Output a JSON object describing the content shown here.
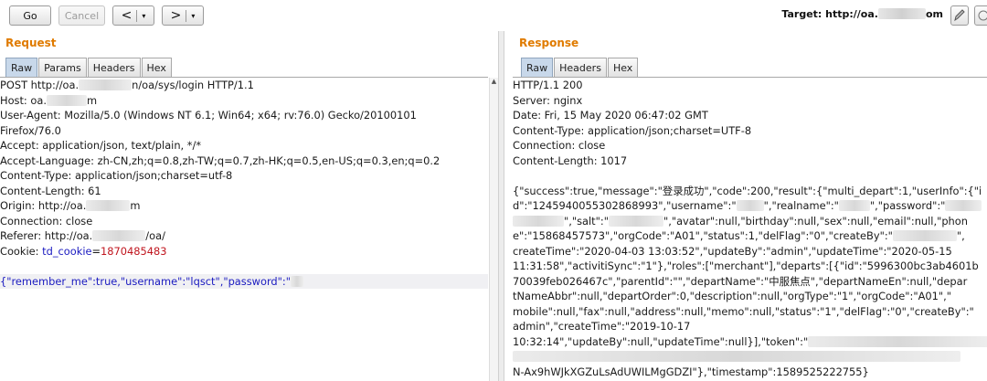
{
  "toolbar": {
    "go_label": "Go",
    "cancel_label": "Cancel",
    "back_label": "<",
    "forward_label": ">",
    "dropdown_glyph": "▾",
    "target_label": "Target: http://oa.",
    "target_suffix": "om"
  },
  "request": {
    "title": "Request",
    "tabs": [
      "Raw",
      "Params",
      "Headers",
      "Hex"
    ],
    "lines": {
      "l1a": "POST http://oa.",
      "l1b": "n/oa/sys/login HTTP/1.1",
      "l2a": "Host: oa.",
      "l2b": "m",
      "l3": "User-Agent: Mozilla/5.0 (Windows NT 6.1; Win64; x64; rv:76.0) Gecko/20100101",
      "l4": "Firefox/76.0",
      "l5": "Accept: application/json, text/plain, */*",
      "l6": "Accept-Language: zh-CN,zh;q=0.8,zh-TW;q=0.7,zh-HK;q=0.5,en-US;q=0.3,en;q=0.2",
      "l7": "Content-Type: application/json;charset=utf-8",
      "l8": "Content-Length: 61",
      "l9a": "Origin: http://oa.",
      "l9b": "m",
      "l10": "Connection: close",
      "l11a": "Referer: http://oa.",
      "l11b": "/oa/",
      "l12a": "Cookie: ",
      "l12b": "td_cookie",
      "l12c": "=",
      "l12d": "1870485483",
      "body": "{\"remember_me\":true,\"username\":\"lqsct\",\"password\":\""
    }
  },
  "response": {
    "title": "Response",
    "tabs": [
      "Raw",
      "Headers",
      "Hex"
    ],
    "headers": [
      "HTTP/1.1 200",
      "Server: nginx",
      "Date: Fri, 15 May 2020 06:47:02 GMT",
      "Content-Type: application/json;charset=UTF-8",
      "Connection: close",
      "Content-Length: 1017"
    ],
    "body": {
      "b1": "{\"success\":true,\"message\":\"登录成功\",\"code\":200,\"result\":{\"multi_depart\":1,\"userInfo\":{\"i",
      "b2a": "d\":\"1245940055302868993\",\"username\":\"",
      "b2b": "\",\"realname\":\"",
      "b2c": "\",\"password\":\"",
      "b3a": "",
      "b3b": "\",\"salt\":\"",
      "b3c": "\",\"avatar\":null,\"birthday\":null,\"sex\":null,\"email\":null,\"phon",
      "b4a": "e\":\"15868457573\",\"orgCode\":\"A01\",\"status\":1,\"delFlag\":\"0\",\"createBy\":\"",
      "b4b": "\",",
      "b5": "createTime\":\"2020-04-03 13:03:52\",\"updateBy\":\"admin\",\"updateTime\":\"2020-05-15",
      "b6": "11:31:58\",\"activitiSync\":\"1\"},\"roles\":[\"merchant\"],\"departs\":[{\"id\":\"5996300bc3ab4601b",
      "b7": "70039feb026467c\",\"parentId\":\"\",\"departName\":\"中服焦点\",\"departNameEn\":null,\"depar",
      "b8": "tNameAbbr\":null,\"departOrder\":0,\"description\":null,\"orgType\":\"1\",\"orgCode\":\"A01\",\"",
      "b9": "mobile\":null,\"fax\":null,\"address\":null,\"memo\":null,\"status\":\"1\",\"delFlag\":\"0\",\"createBy\":\"",
      "b10": "admin\",\"createTime\":\"2019-10-17",
      "b11a": "10:32:14\",\"updateBy\":null,\"updateTime\":null}],\"token\":\"",
      "b13": "N-Ax9hWJkXGZuLsAdUWILMgGDZI\"},\"timestamp\":1589525222755}"
    }
  }
}
